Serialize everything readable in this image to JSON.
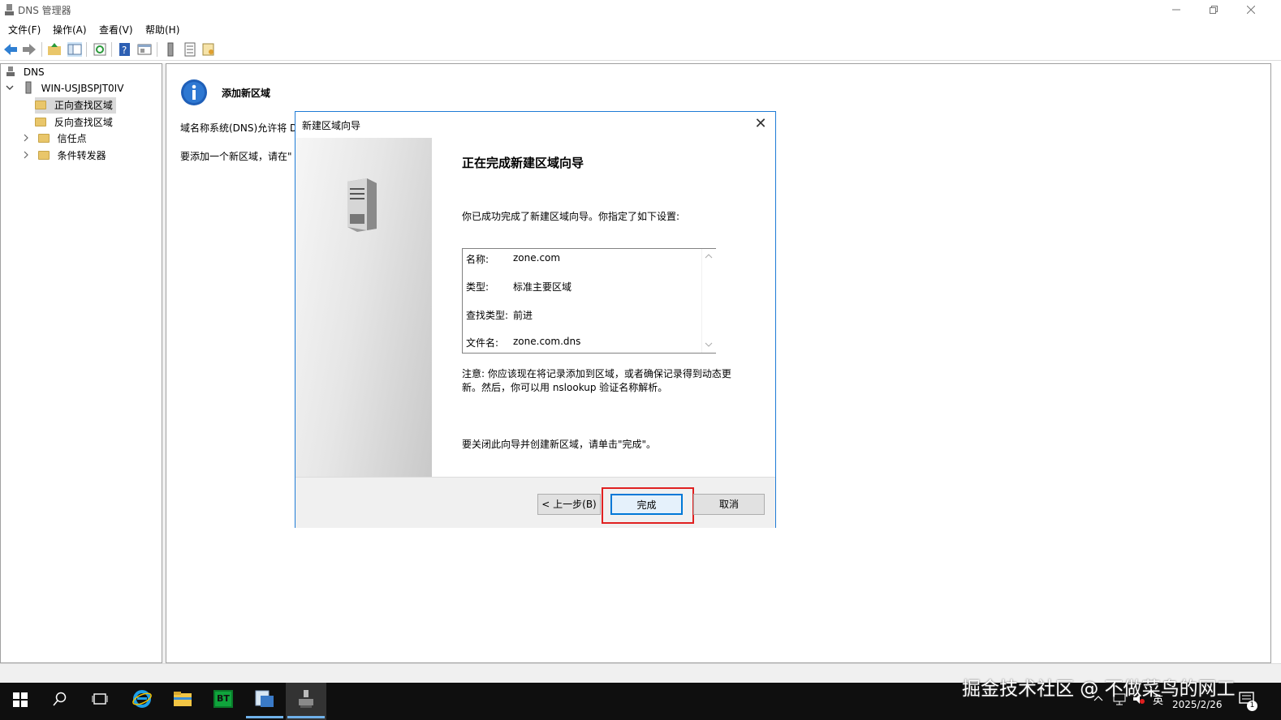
{
  "window": {
    "title": "DNS 管理器"
  },
  "menu": [
    "文件(F)",
    "操作(A)",
    "查看(V)",
    "帮助(H)"
  ],
  "tree": {
    "root": "DNS",
    "server": "WIN-USJBSPJT0IV",
    "children": [
      "正向查找区域",
      "反向查找区域",
      "信任点",
      "条件转发器"
    ]
  },
  "main": {
    "heading": "添加新区域",
    "para1": "域名称系统(DNS)允许将 D",
    "para2": "要添加一个新区域，请在\""
  },
  "dialog": {
    "title": "新建区域向导",
    "close": "✕",
    "heading": "正在完成新建区域向导",
    "intro": "你已成功完成了新建区域向导。你指定了如下设置:",
    "summary": [
      {
        "label": "名称:",
        "value": "zone.com"
      },
      {
        "label": "类型:",
        "value": "标准主要区域"
      },
      {
        "label": "查找类型:",
        "value": "前进"
      },
      {
        "label": "文件名:",
        "value": "zone.com.dns"
      }
    ],
    "note_line1": "注意: 你应该现在将记录添加到区域，或者确保记录得到动态更",
    "note_line2": "新。然后，你可以用 nslookup 验证名称解析。",
    "close_hint": "要关闭此向导并创建新区域，请单击\"完成\"。",
    "buttons": {
      "back": "< 上一步(B)",
      "finish": "完成",
      "cancel": "取消"
    }
  },
  "taskbar": {
    "watermark": "掘金技术社区 @ 不做菜鸟的网工",
    "ime": "英",
    "date": "2025/2/26",
    "notif_count": "1"
  },
  "colors": {
    "accent": "#1e7bd6",
    "highlight": "#e02020",
    "taskbar": "#0f0f0f"
  }
}
